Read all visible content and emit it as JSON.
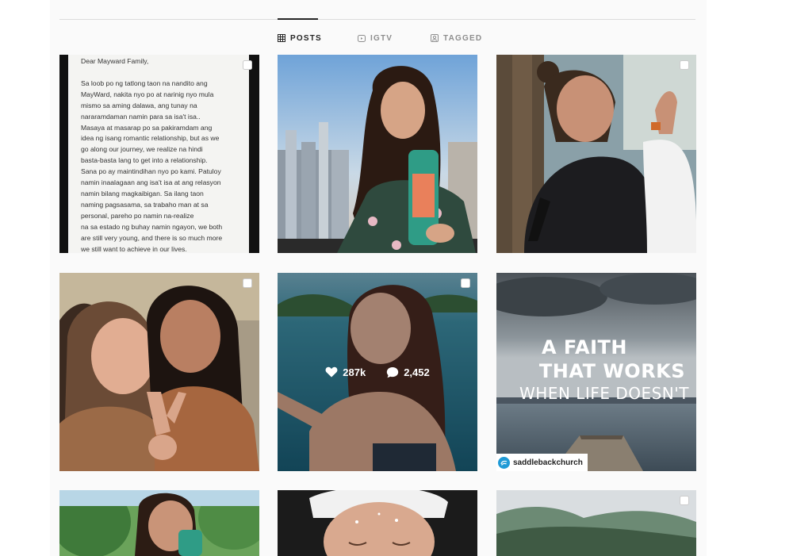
{
  "tabs": [
    {
      "label": "POSTS",
      "icon": "grid-icon",
      "active": true
    },
    {
      "label": "IGTV",
      "icon": "igtv-icon",
      "active": false
    },
    {
      "label": "TAGGED",
      "icon": "tagged-icon",
      "active": false
    }
  ],
  "posts": [
    {
      "kind": "letter",
      "letter": {
        "salutation": "Dear Mayward Family,",
        "lines": [
          "Sa loob po ng tatlong taon na nandito ang",
          "MayWard, nakita nyo po at narinig nyo mula",
          "mismo sa aming dalawa, ang tunay na",
          "nararamdaman namin para sa isa't isa..",
          "Masaya at masarap po sa pakiramdam ang",
          "idea ng isang romantic relationship, but as we",
          "go along our journey, we realize na hindi",
          "basta-basta lang to get into a relationship.",
          "Sana po ay maintindihan nyo po kami. Patuloy",
          "namin inaalagaan ang isa't isa at ang relasyon",
          "namin bilang magkaibigan. Sa ilang taon",
          "naming pagsasama, sa trabaho man at sa",
          "personal, pareho po namin na-realize",
          "na sa estado ng buhay namin ngayon, we both",
          "are still very young, and there is so much more",
          "we still want to achieve in our lives."
        ]
      }
    },
    {
      "kind": "photo"
    },
    {
      "kind": "photo"
    },
    {
      "kind": "photo"
    },
    {
      "kind": "photo",
      "likes": "287k",
      "comments": "2,452"
    },
    {
      "kind": "quote",
      "quote": {
        "line1": "A FAITH",
        "line2": "THAT WORKS",
        "line3": "WHEN LIFE DOESN'T"
      },
      "handle": "saddlebackchurch"
    },
    {
      "kind": "photo"
    },
    {
      "kind": "photo"
    },
    {
      "kind": "photo"
    }
  ],
  "colors": {
    "accent": "#262626",
    "muted": "#8e8e8e",
    "background": "#fafafa"
  }
}
